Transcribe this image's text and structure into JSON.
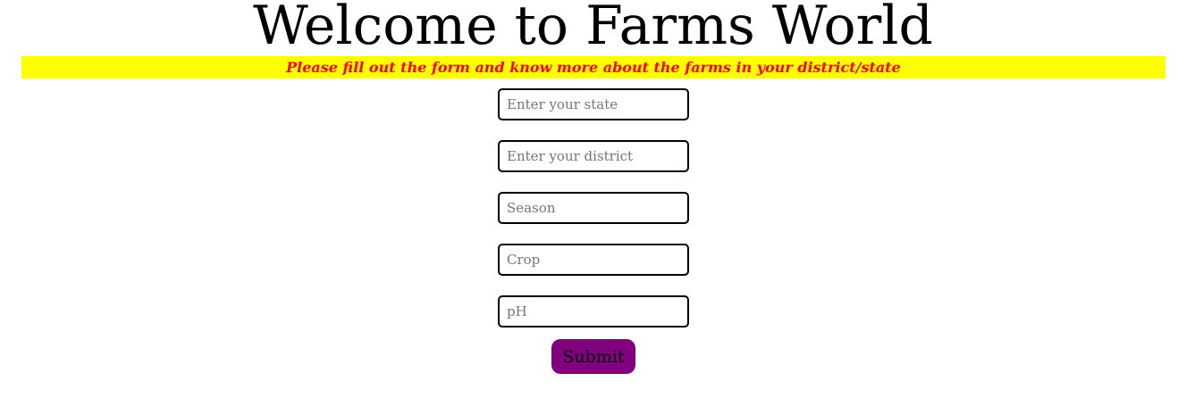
{
  "header": {
    "title": "Welcome to Farms World",
    "subtitle": "Please fill out the form and know more about the farms in your district/state"
  },
  "form": {
    "fields": [
      {
        "placeholder": "Enter your state",
        "value": ""
      },
      {
        "placeholder": "Enter your district",
        "value": ""
      },
      {
        "placeholder": "Season",
        "value": ""
      },
      {
        "placeholder": "Crop",
        "value": ""
      },
      {
        "placeholder": "pH",
        "value": ""
      }
    ],
    "submit_label": "Submit"
  },
  "colors": {
    "banner_background": "#ffff00",
    "banner_text": "#ff0000",
    "submit_background": "#800080"
  }
}
